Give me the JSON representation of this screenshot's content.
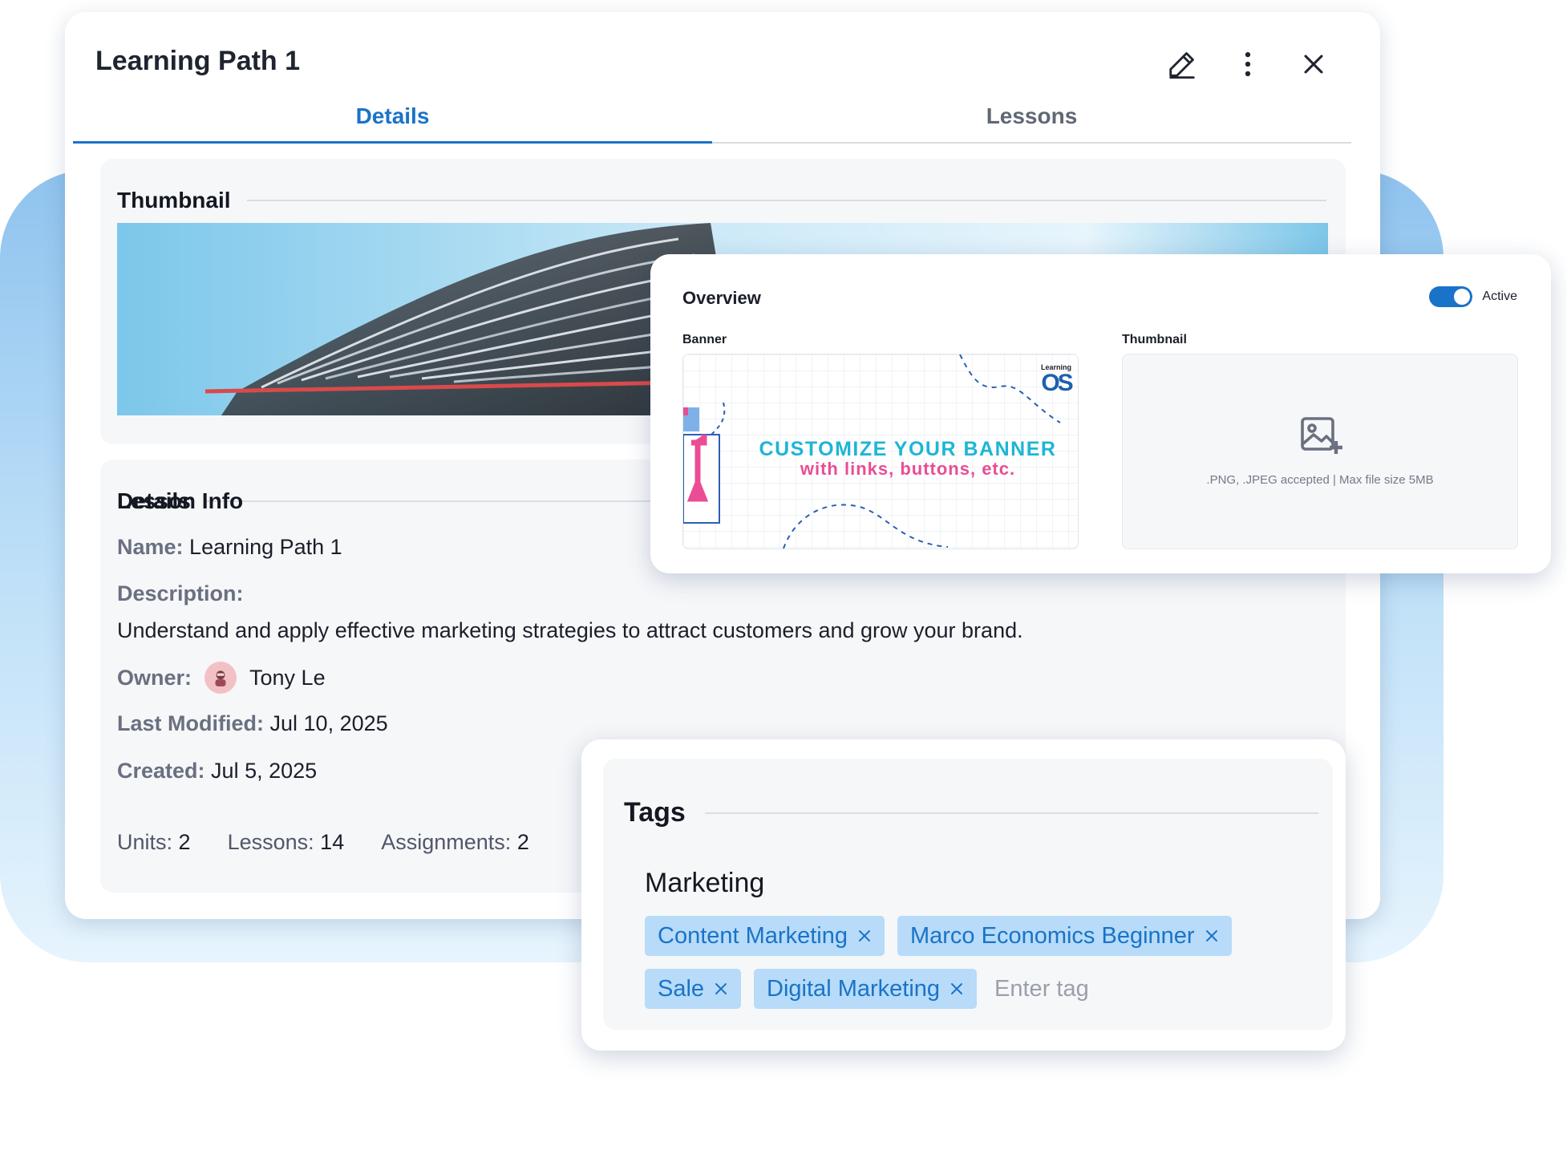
{
  "main": {
    "title": "Learning Path 1",
    "tabs": [
      {
        "label": "Details"
      },
      {
        "label": "Lessons"
      }
    ],
    "thumbnail_section": {
      "title": "Thumbnail"
    },
    "details_section": {
      "title": "Details",
      "name_label": "Name:",
      "name_value": "Learning Path 1",
      "description_label": "Description:",
      "description_value": "Understand and apply effective marketing strategies to attract customers and grow your brand.",
      "owner_label": "Owner:",
      "owner_value": "Tony Le",
      "modified_label": "Last Modified:",
      "modified_value": "Jul 10, 2025",
      "created_label": "Created:",
      "created_value": "Jul 5, 2025"
    },
    "lesson_info": {
      "title": "Lesson Info",
      "units_label": "Units:",
      "units_value": "2",
      "lessons_label": "Lessons:",
      "lessons_value": "14",
      "assignments_label": "Assignments:",
      "assignments_value": "2"
    }
  },
  "overview": {
    "title": "Overview",
    "toggle_label": "Active",
    "toggle_on": true,
    "banner_label": "Banner",
    "banner_logo_small": "Learning",
    "banner_logo_big": "OS",
    "banner_line1": "CUSTOMIZE YOUR BANNER",
    "banner_line2": "with links, buttons, etc.",
    "thumbnail_label": "Thumbnail",
    "thumbnail_note": ".PNG, .JPEG accepted  |   Max file size 5MB"
  },
  "tags": {
    "title": "Tags",
    "group": "Marketing",
    "items": [
      {
        "label": "Content Marketing"
      },
      {
        "label": "Marco Economics Beginner"
      },
      {
        "label": "Sale"
      },
      {
        "label": "Digital Marketing"
      }
    ],
    "input_placeholder": "Enter tag"
  },
  "colors": {
    "accent": "#1a73c8",
    "chip_bg": "#b7dbf8",
    "banner_cyan": "#1eb5d6",
    "banner_pink": "#ea4d93"
  },
  "icons": [
    "edit-icon",
    "more-vertical-icon",
    "close-icon",
    "avatar-icon",
    "image-add-icon",
    "tag-remove-icon"
  ]
}
